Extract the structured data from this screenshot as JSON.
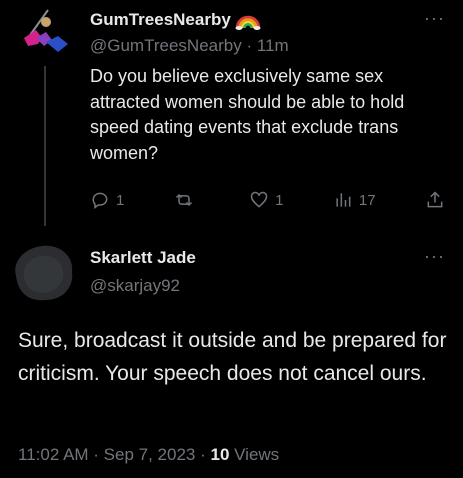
{
  "original_tweet": {
    "display_name": "GumTreesNearby",
    "name_emoji": "rainbow-icon",
    "handle": "@GumTreesNearby",
    "separator": "·",
    "time": "11m",
    "more_label": "···",
    "text": "Do you believe exclusively same sex attracted women should be able to hold speed dating events that exclude trans women?",
    "actions": {
      "reply_count": "1",
      "retweet_count": "",
      "like_count": "1",
      "views_count": "17"
    }
  },
  "reply_tweet": {
    "display_name": "Skarlett Jade",
    "handle": "@skarjay92",
    "more_label": "···",
    "text": "Sure, broadcast it outside and be prepared for criticism. Your speech does not cancel ours.",
    "timestamp": "11:02 AM · Sep 7, 2023 · ",
    "views_number": "10",
    "views_label": " Views"
  },
  "colors": {
    "background": "#000000",
    "text_primary": "#e7e9ea",
    "text_secondary": "#71767b",
    "thread_line": "#333639"
  }
}
